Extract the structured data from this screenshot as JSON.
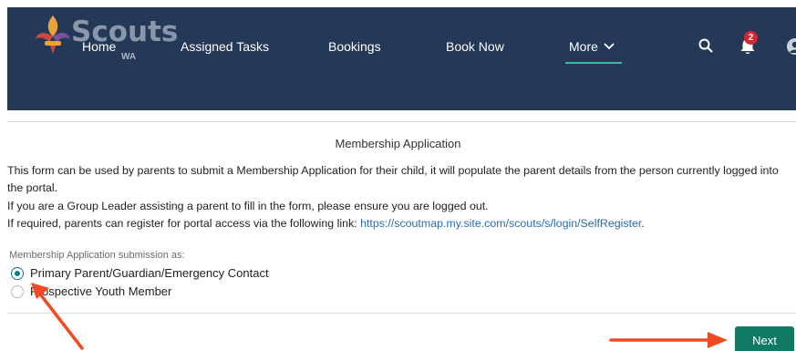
{
  "nav": {
    "logo_word": "Scouts",
    "logo_sub": "WA",
    "items": [
      {
        "label": "Home"
      },
      {
        "label": "Assigned Tasks"
      },
      {
        "label": "Bookings"
      },
      {
        "label": "Book Now"
      },
      {
        "label": "More"
      }
    ],
    "notification_count": "2"
  },
  "form": {
    "title": "Membership Application",
    "para1": "This form can be used by parents to submit a Membership Application for their child, it will populate the parent details from the person currently logged into the portal.",
    "para2": "If you are a Group Leader assisting a parent to fill in the form, please ensure you are logged out.",
    "para3_prefix": "If required, parents can register for portal access via the following link: ",
    "para3_link": "https://scoutmap.my.site.com/scouts/s/login/SelfRegister",
    "para3_suffix": ".",
    "submission_label": "Membership Application submission as:",
    "options": [
      {
        "label": "Primary Parent/Guardian/Emergency Contact",
        "selected": true
      },
      {
        "label": "Prospective Youth Member",
        "selected": false
      }
    ],
    "next_label": "Next"
  },
  "colors": {
    "navbar_bg": "#243858",
    "accent": "#3fb7a4",
    "next_button": "#117a65",
    "link": "#2b6cb0",
    "annotation_arrow": "#f04a24",
    "badge": "#d8262c"
  }
}
